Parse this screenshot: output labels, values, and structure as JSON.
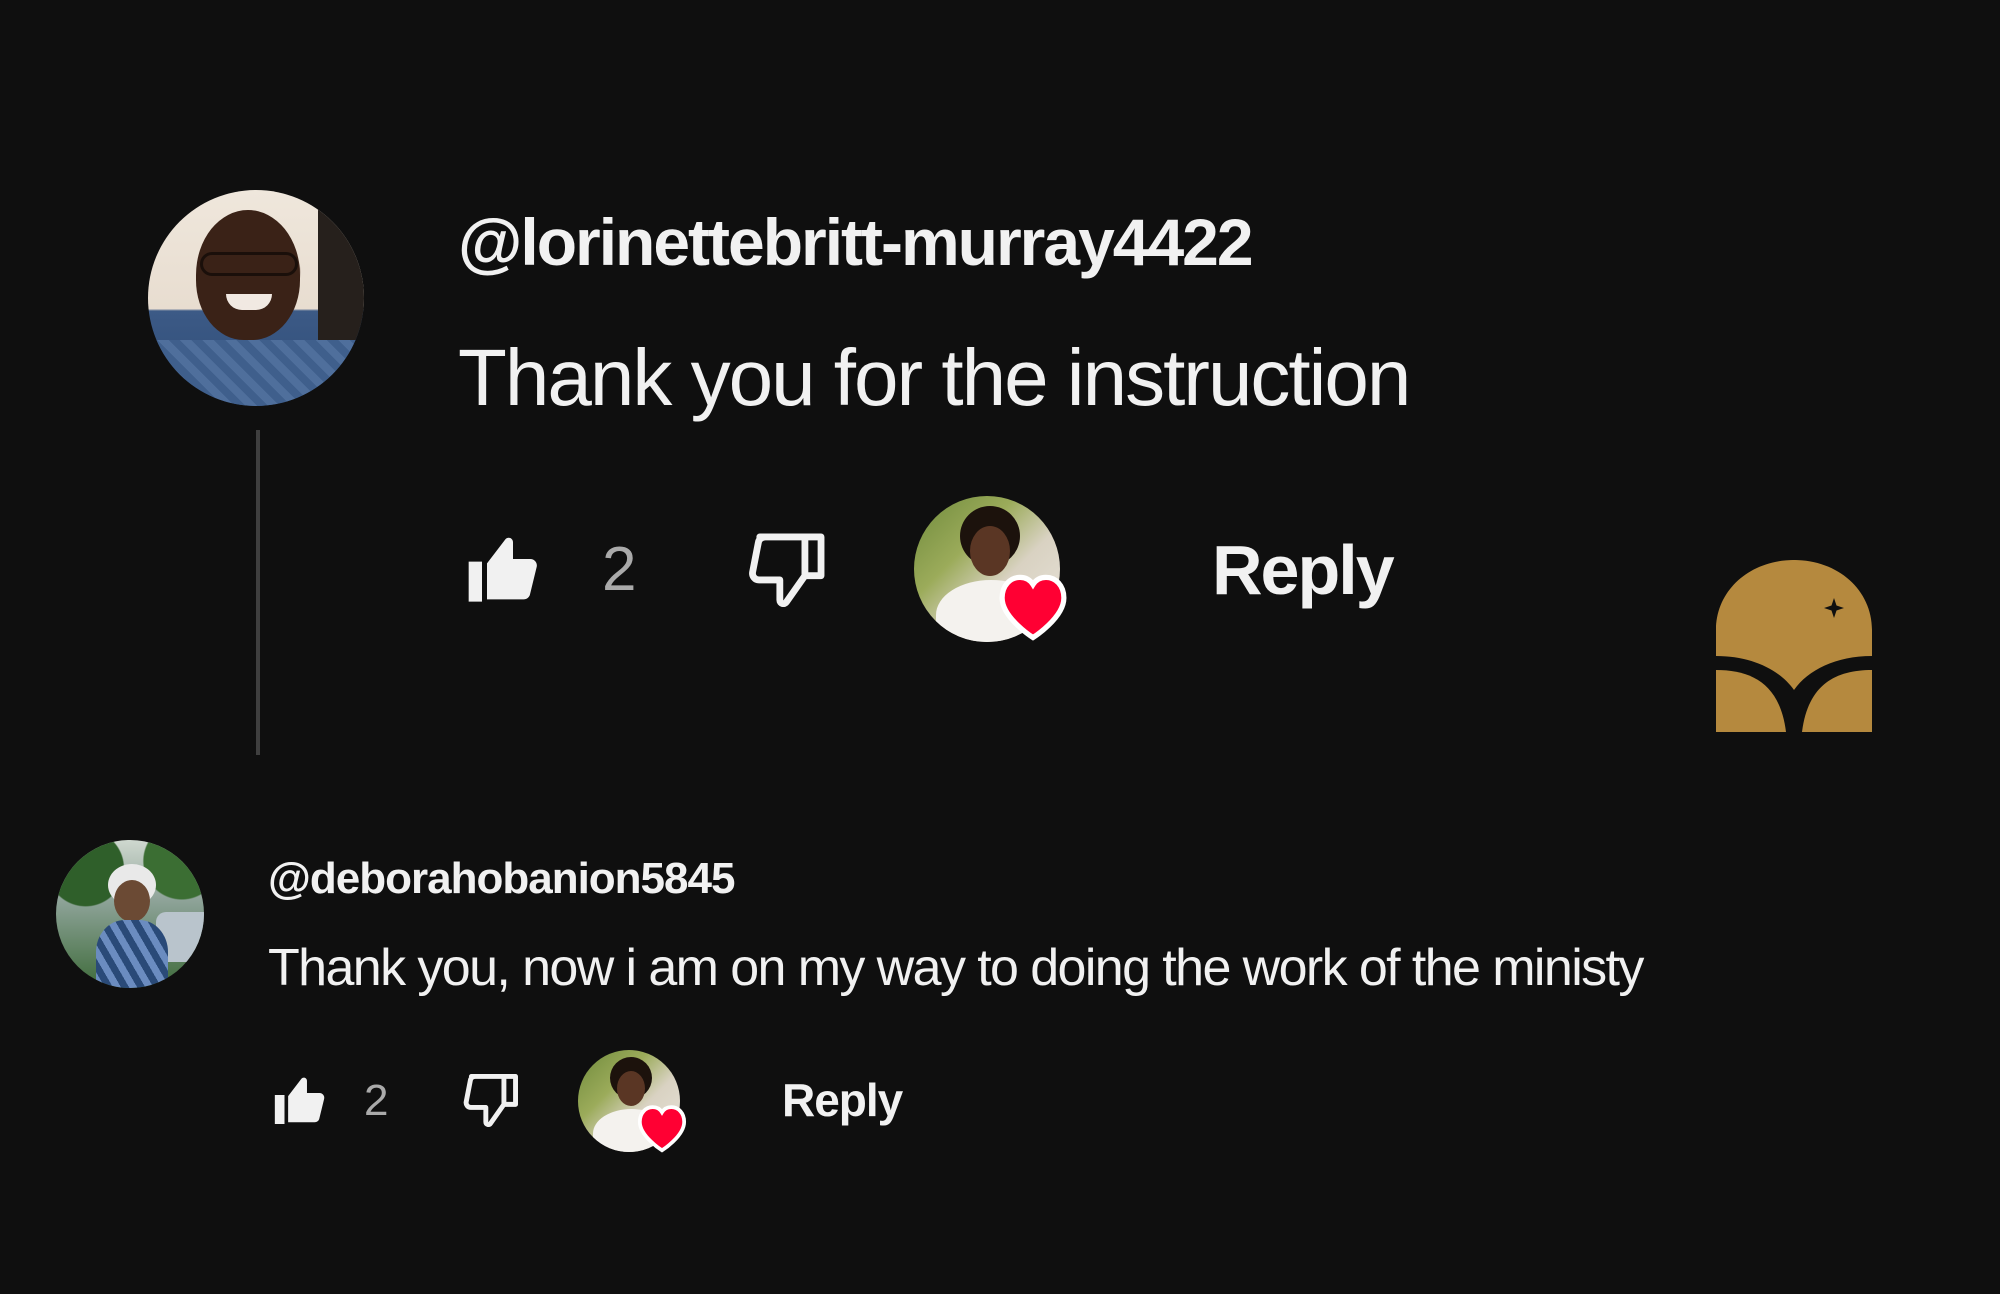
{
  "colors": {
    "background": "#0f0f0f",
    "text_primary": "#f1f1f1",
    "text_secondary": "#aaaaaa",
    "heart": "#ff0033",
    "logo_gold": "#b5893e"
  },
  "comments": [
    {
      "author": "@lorinettebritt-murray4422",
      "text": "Thank you for the instruction",
      "like_count": "2",
      "reply_label": "Reply",
      "icons": {
        "like": "thumbs-up-icon",
        "dislike": "thumbs-down-icon",
        "creator_heart": "creator-heart-icon"
      }
    },
    {
      "author": "@deborahobanion5845",
      "text": "Thank you, now i am on my way to doing the work of the ministy",
      "like_count": "2",
      "reply_label": "Reply",
      "icons": {
        "like": "thumbs-up-icon",
        "dislike": "thumbs-down-icon",
        "creator_heart": "creator-heart-icon"
      }
    }
  ],
  "logo": {
    "icon": "sparkle-arch-logo"
  }
}
